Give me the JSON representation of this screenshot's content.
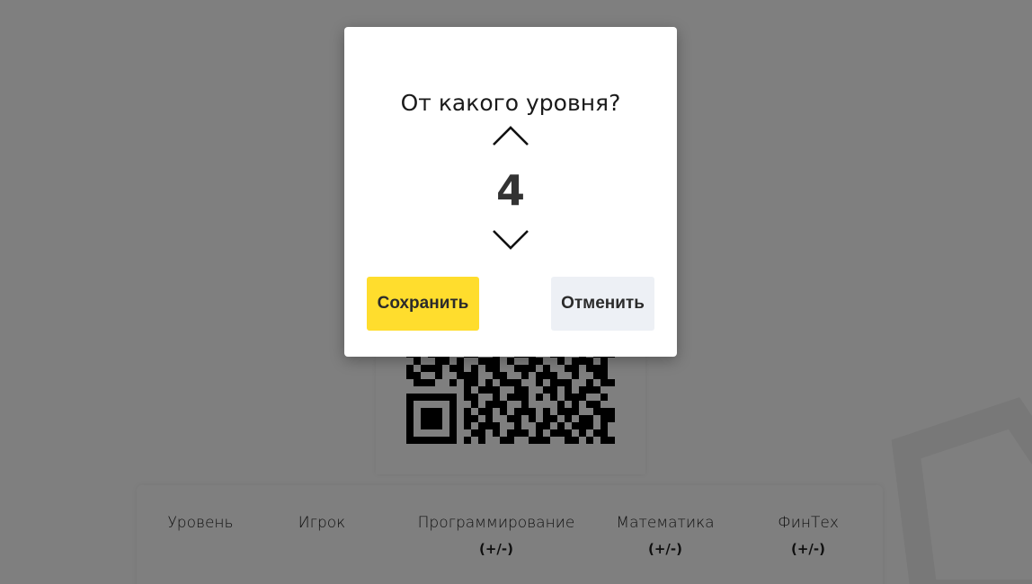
{
  "modal": {
    "title": "От какого уровня?",
    "value": "4",
    "save_label": "Сохранить",
    "cancel_label": "Отменить",
    "up_icon": "chevron-up-icon",
    "down_icon": "chevron-down-icon"
  },
  "table": {
    "columns": [
      {
        "label": "Уровень",
        "sub": ""
      },
      {
        "label": "Игрок",
        "sub": ""
      },
      {
        "label": "Программирование",
        "sub": "(+/-)"
      },
      {
        "label": "Математика",
        "sub": "(+/-)"
      },
      {
        "label": "ФинТех",
        "sub": "(+/-)"
      }
    ]
  },
  "colors": {
    "save_button": "#ffdd2d",
    "cancel_button": "#edf0f5",
    "overlay": "rgba(0,0,0,0.5)"
  }
}
